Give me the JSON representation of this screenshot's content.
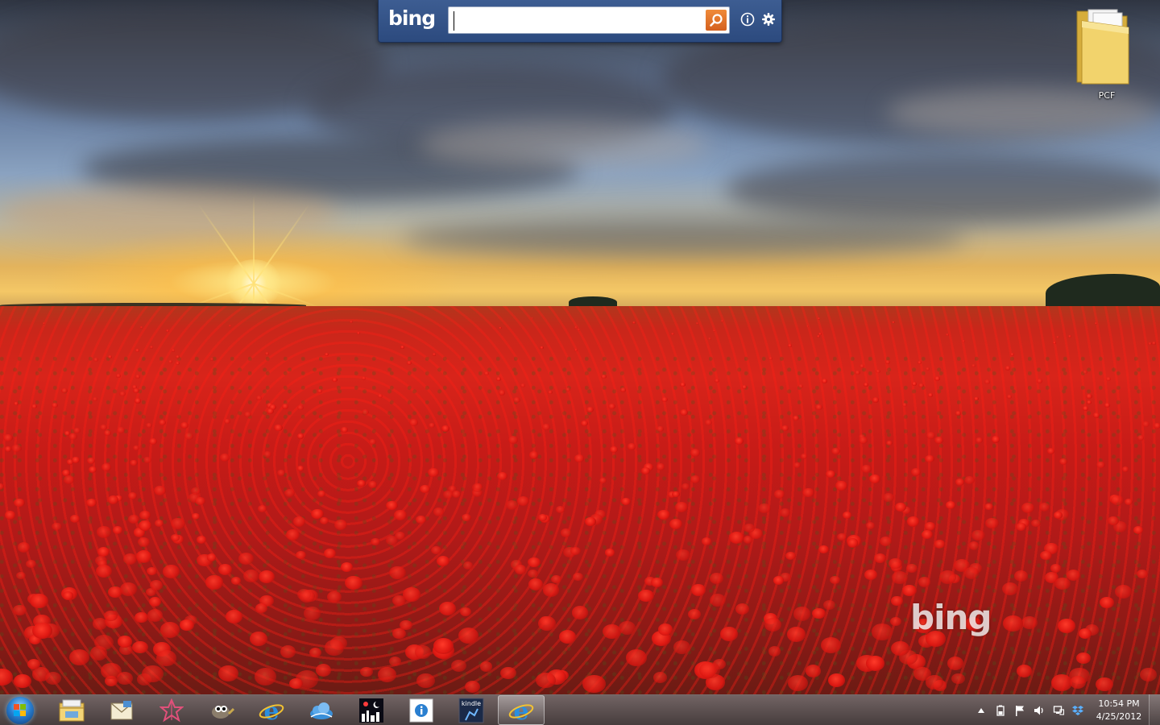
{
  "bing_gadget": {
    "logo": "bing",
    "search_value": "",
    "go_icon": "search-icon",
    "info_icon": "info-icon",
    "settings_icon": "gear-icon",
    "accent": "#e2702a"
  },
  "desktop": {
    "icons": [
      {
        "label": "PCF",
        "icon": "folder-icon"
      }
    ],
    "watermark": "bing"
  },
  "taskbar": {
    "start_icon": "windows-start-orb",
    "pinned": [
      {
        "name": "windows-explorer",
        "icon": "folder-icon"
      },
      {
        "name": "mail-app",
        "icon": "mail-icon"
      },
      {
        "name": "star-app",
        "icon": "star-app-icon"
      },
      {
        "name": "gimp",
        "icon": "gimp-icon"
      },
      {
        "name": "internet-explorer",
        "icon": "internet-explorer-icon"
      },
      {
        "name": "skydrive",
        "icon": "cloud-icon"
      },
      {
        "name": "weather-app",
        "icon": "night-city-icon"
      },
      {
        "name": "info-app",
        "icon": "info-icon"
      },
      {
        "name": "kindle",
        "icon": "kindle-icon",
        "label": "kindle"
      },
      {
        "name": "internet-explorer-active",
        "icon": "internet-explorer-icon",
        "active": true
      }
    ],
    "tray": {
      "icons": [
        "chevron-up-icon",
        "battery-icon",
        "flag-icon",
        "speaker-icon",
        "network-icon",
        "dropbox-icon"
      ],
      "time": "10:54 PM",
      "date": "4/25/2012"
    }
  }
}
